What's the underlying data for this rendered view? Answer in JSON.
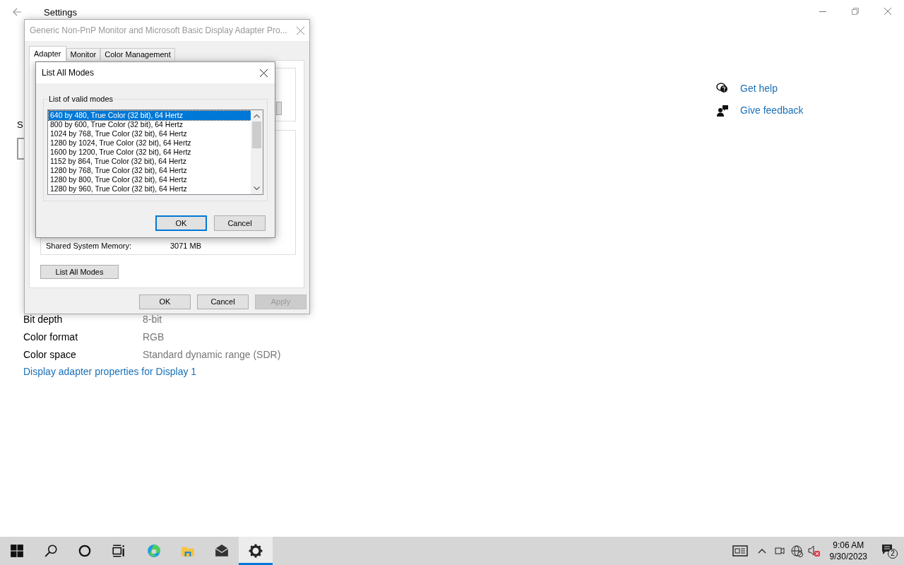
{
  "settings_window": {
    "title": "Settings",
    "partial_label": "S",
    "display_info": [
      {
        "label": "Bit depth",
        "value": "8-bit"
      },
      {
        "label": "Color format",
        "value": "RGB"
      },
      {
        "label": "Color space",
        "value": "Standard dynamic range (SDR)"
      }
    ],
    "adapter_link": "Display adapter properties for Display 1",
    "related": [
      {
        "kind": "help",
        "label": "Get help"
      },
      {
        "kind": "feedback",
        "label": "Give feedback"
      }
    ]
  },
  "properties_dialog": {
    "title": "Generic Non-PnP Monitor and Microsoft Basic Display Adapter Pro...",
    "tabs": [
      {
        "label": "Adapter",
        "selected": true
      },
      {
        "label": "Monitor",
        "selected": false
      },
      {
        "label": "Color Management",
        "selected": false
      }
    ],
    "memory": {
      "label": "Shared System Memory:",
      "value": "3071 MB"
    },
    "list_button": "List All Modes",
    "buttons": [
      {
        "label": "OK",
        "disabled": false
      },
      {
        "label": "Cancel",
        "disabled": false
      },
      {
        "label": "Apply",
        "disabled": true
      }
    ]
  },
  "modes_dialog": {
    "title": "List All Modes",
    "group_label": "List of valid modes",
    "modes": [
      {
        "label": "640 by 480, True Color (32 bit), 64 Hertz",
        "selected": true
      },
      {
        "label": "800 by 600, True Color (32 bit), 64 Hertz",
        "selected": false
      },
      {
        "label": "1024 by 768, True Color (32 bit), 64 Hertz",
        "selected": false
      },
      {
        "label": "1280 by 1024, True Color (32 bit), 64 Hertz",
        "selected": false
      },
      {
        "label": "1600 by 1200, True Color (32 bit), 64 Hertz",
        "selected": false
      },
      {
        "label": "1152 by 864, True Color (32 bit), 64 Hertz",
        "selected": false
      },
      {
        "label": "1280 by 768, True Color (32 bit), 64 Hertz",
        "selected": false
      },
      {
        "label": "1280 by 800, True Color (32 bit), 64 Hertz",
        "selected": false
      },
      {
        "label": "1280 by 960, True Color (32 bit), 64 Hertz",
        "selected": false
      }
    ],
    "buttons": [
      {
        "label": "OK",
        "focused": true
      },
      {
        "label": "Cancel",
        "focused": false
      }
    ]
  },
  "taskbar": {
    "apps": [
      {
        "kind": "start",
        "selected": false
      },
      {
        "kind": "search",
        "selected": false
      },
      {
        "kind": "cortana",
        "selected": false
      },
      {
        "kind": "taskview",
        "selected": false
      },
      {
        "kind": "edge",
        "selected": false
      },
      {
        "kind": "explorer",
        "selected": false
      },
      {
        "kind": "mail",
        "selected": false
      },
      {
        "kind": "settings",
        "selected": true
      }
    ],
    "clock": {
      "time": "9:06 AM",
      "date": "9/30/2023"
    },
    "notification_count": "2"
  }
}
